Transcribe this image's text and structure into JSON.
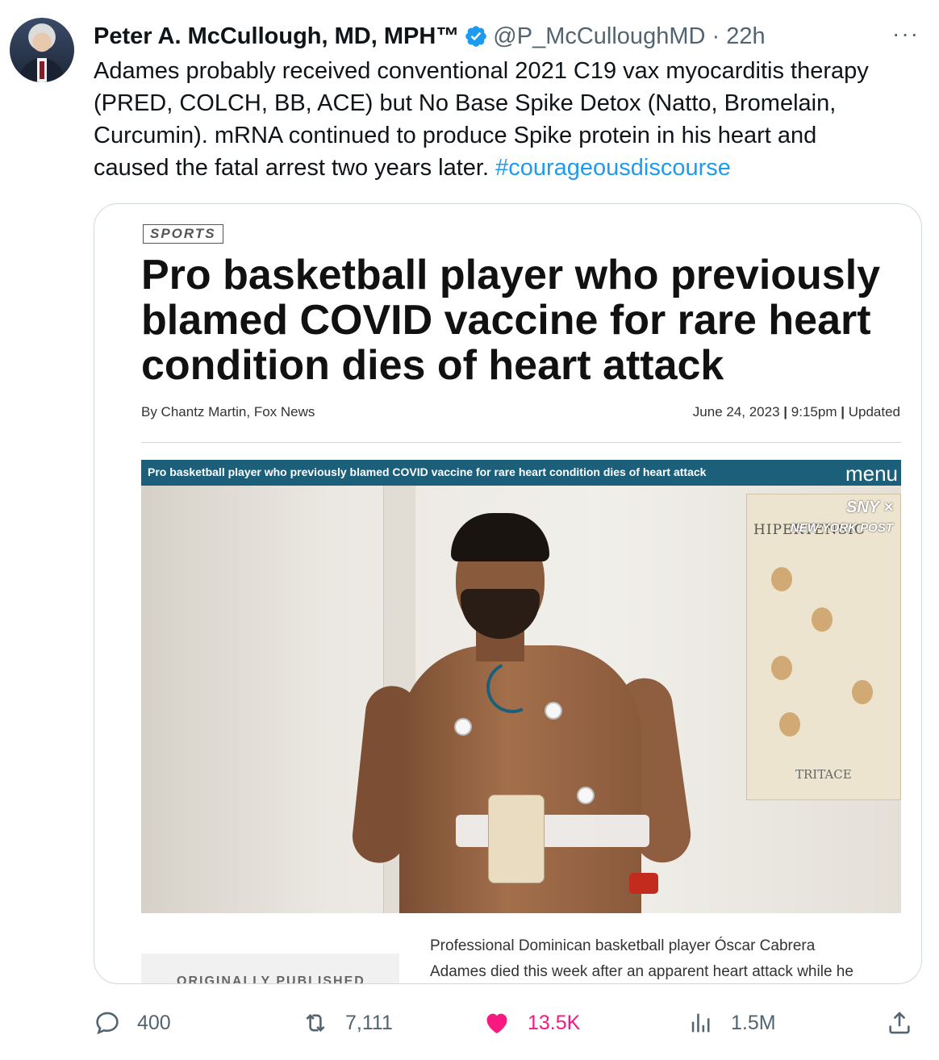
{
  "tweet": {
    "author_name": "Peter A. McCullough, MD, MPH™",
    "handle": "@P_McCulloughMD",
    "separator": "·",
    "time": "22h",
    "more_label": "···",
    "text": "Adames probably received conventional 2021 C19 vax myocarditis therapy\n(PRED, COLCH, BB, ACE) but No Base Spike Detox (Natto, Bromelain,\nCurcumin).  mRNA continued to produce Spike protein in his heart and\ncaused the fatal arrest two years later.  ",
    "hashtag": "#courageousdiscourse",
    "verified_icon": "verified-badge-icon",
    "accent_color": "#1d9bf0"
  },
  "card": {
    "section": "SPORTS",
    "headline": "Pro basketball player who previously blamed COVID vaccine for rare heart condition dies of heart attack",
    "byline": "By Chantz Martin, Fox News",
    "date": "June 24, 2023",
    "time": "9:15pm",
    "updated": "Updated",
    "divider": "|",
    "video_title": "Pro basketball player who previously blamed COVID vaccine for rare heart condition dies of heart attack",
    "video_menu": "menu",
    "watermark_1": "SNY",
    "watermark_x": "×",
    "watermark_2": "NEW YORK POST",
    "poster_title": "HIPERTENSIC",
    "poster_footer": "TRITACE",
    "sidebar_label": "ORIGINALLY PUBLISHED",
    "body_text": "Professional Dominican basketball player Óscar Cabrera\nAdames died this week after an apparent heart attack while he"
  },
  "actions": {
    "replies": "400",
    "retweets": "7,111",
    "likes": "13.5K",
    "views": "1.5M",
    "like_color": "#f91880",
    "icons": [
      "reply-icon",
      "retweet-icon",
      "heart-icon",
      "views-icon",
      "share-icon"
    ]
  }
}
